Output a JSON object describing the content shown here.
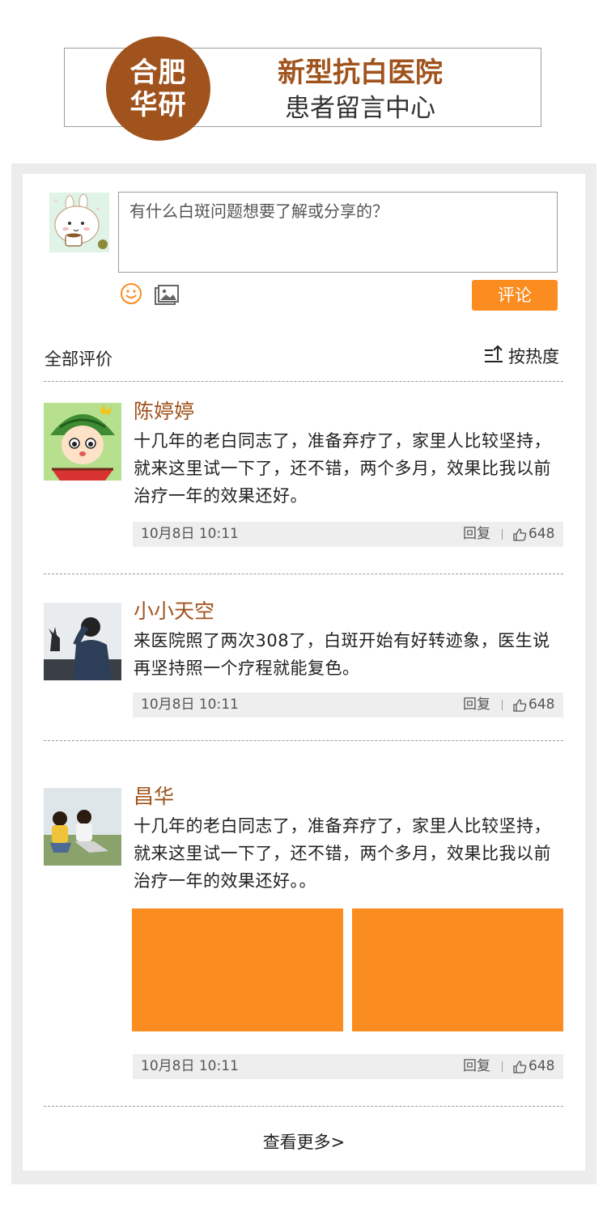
{
  "header": {
    "logo_line1": "合肥",
    "logo_line2": "华研",
    "title": "新型抗白医院",
    "subtitle": "患者留言中心"
  },
  "composer": {
    "placeholder": "有什么白斑问题想要了解或分享的？",
    "submit_label": "评论",
    "emoji_icon": "smiley-icon",
    "image_icon": "image-icon"
  },
  "list": {
    "all_label": "全部评价",
    "sort_label": "按热度",
    "more_label": "查看更多>"
  },
  "comments": [
    {
      "name": "陈婷婷",
      "text": "十几年的老白同志了，准备弃疗了，家里人比较坚持，就来这里试一下了，还不错，两个多月，效果比我以前治疗一年的效果还好。",
      "time": "10月8日 10:11",
      "reply": "回复",
      "likes": "648"
    },
    {
      "name": "小小天空",
      "text": "来医院照了两次308了，白斑开始有好转迹象，医生说再坚持照一个疗程就能复色。",
      "time": "10月8日 10:11",
      "reply": "回复",
      "likes": "648"
    },
    {
      "name": "昌华",
      "text": "十几年的老白同志了，准备弃疗了，家里人比较坚持，就来这里试一下了，还不错，两个多月，效果比我以前治疗一年的效果还好。。",
      "time": "10月8日 10:11",
      "reply": "回复",
      "likes": "648"
    }
  ],
  "colors": {
    "brand_brown": "#a0531d",
    "accent_orange": "#fb8c20"
  }
}
